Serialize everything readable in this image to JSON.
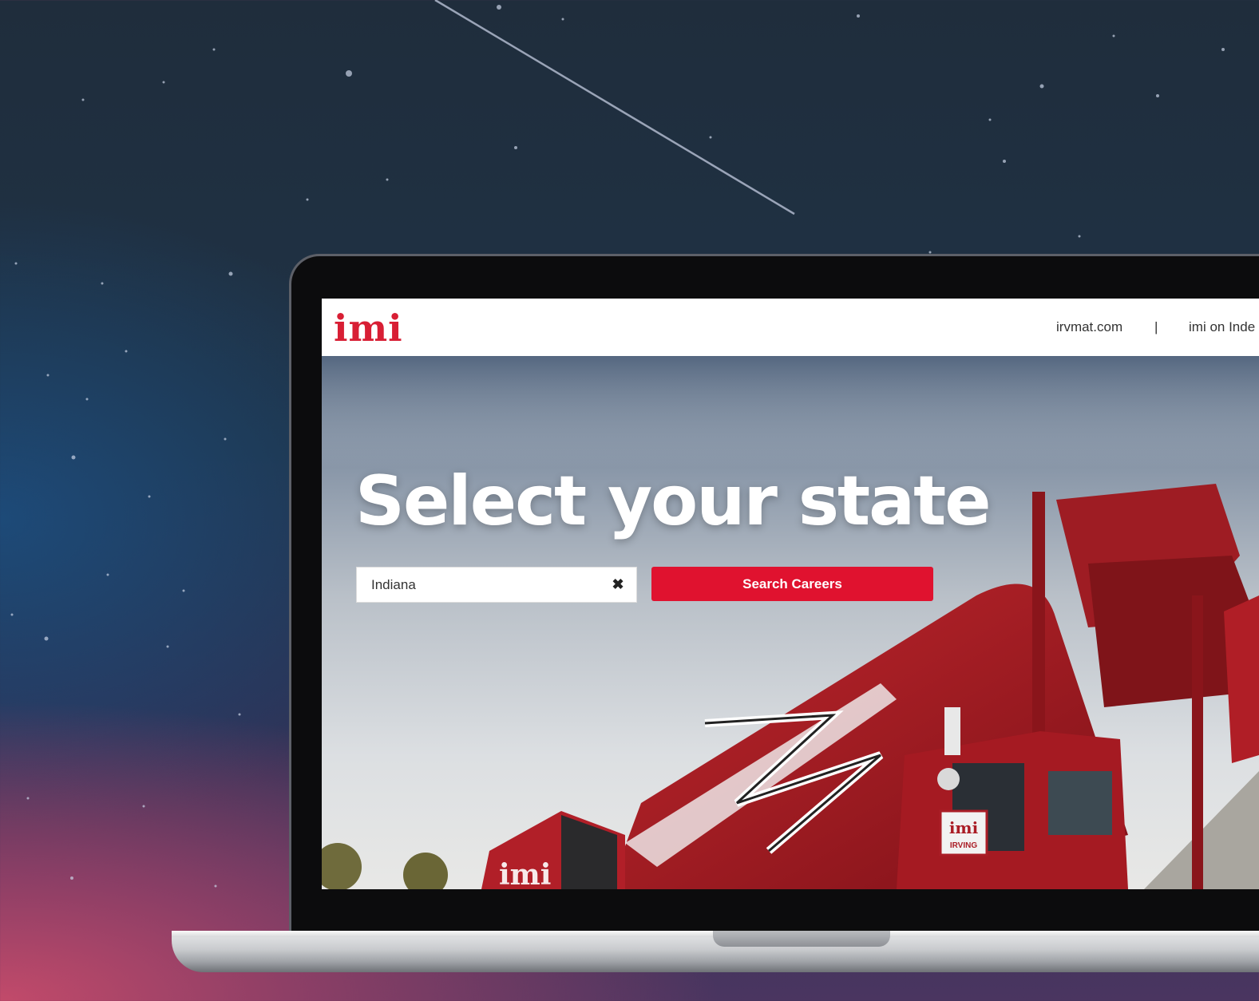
{
  "header": {
    "logo": "imi",
    "nav": [
      {
        "label": "irvmat.com"
      },
      {
        "label": "|"
      },
      {
        "label": "imi on Inde"
      }
    ]
  },
  "hero": {
    "headline": "Select your state",
    "state_input": {
      "value": "Indiana",
      "clear_symbol": "✖"
    },
    "search_button": "Search Careers",
    "truck_brand": "imi",
    "truck_plate_top": "imi",
    "truck_plate_bottom": "IRVING"
  },
  "colors": {
    "brand_red": "#e0122f",
    "logo_red": "#d81e34"
  }
}
